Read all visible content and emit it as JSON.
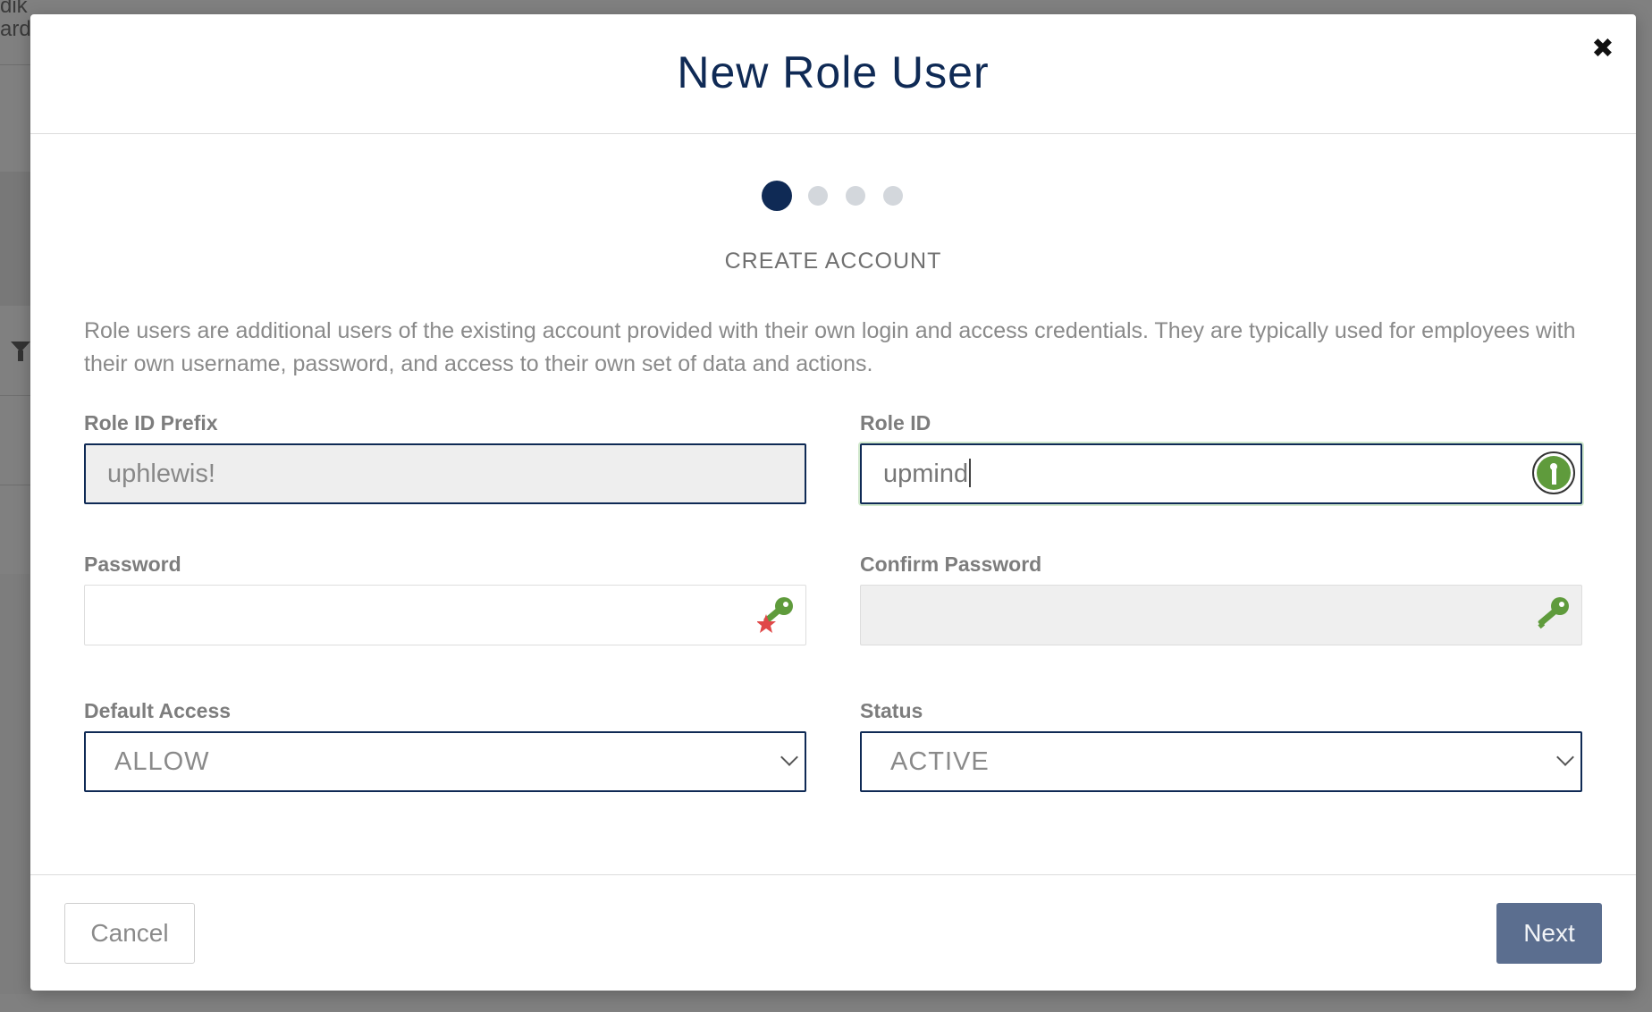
{
  "background": {
    "partial_text_1": "dik",
    "partial_text_2": "ard"
  },
  "modal": {
    "title": "New Role User",
    "close_symbol": "✖",
    "stepper": {
      "step_count": 4,
      "active_step": 1,
      "current_label": "CREATE ACCOUNT"
    },
    "description": "Role users are additional users of the existing account provided with their own login and access credentials. They are typically used for employees with their own username, password, and access to their own set of data and actions.",
    "fields": {
      "role_id_prefix": {
        "label": "Role ID Prefix",
        "value": "uphlewis!"
      },
      "role_id": {
        "label": "Role ID",
        "value": "upmind",
        "icon": "keepass-icon"
      },
      "password": {
        "label": "Password",
        "value": "",
        "icon": "key-star-icon"
      },
      "confirm_password": {
        "label": "Confirm Password",
        "value": "",
        "icon": "key-icon"
      },
      "default_access": {
        "label": "Default Access",
        "value": "ALLOW"
      },
      "status": {
        "label": "Status",
        "value": "ACTIVE"
      }
    },
    "footer": {
      "cancel_label": "Cancel",
      "next_label": "Next"
    }
  },
  "colors": {
    "primary_navy": "#0f2a55",
    "next_button": "#5b6e8f",
    "key_green": "#5f9b3c",
    "star_red": "#e04848",
    "overlay": "#808080"
  }
}
